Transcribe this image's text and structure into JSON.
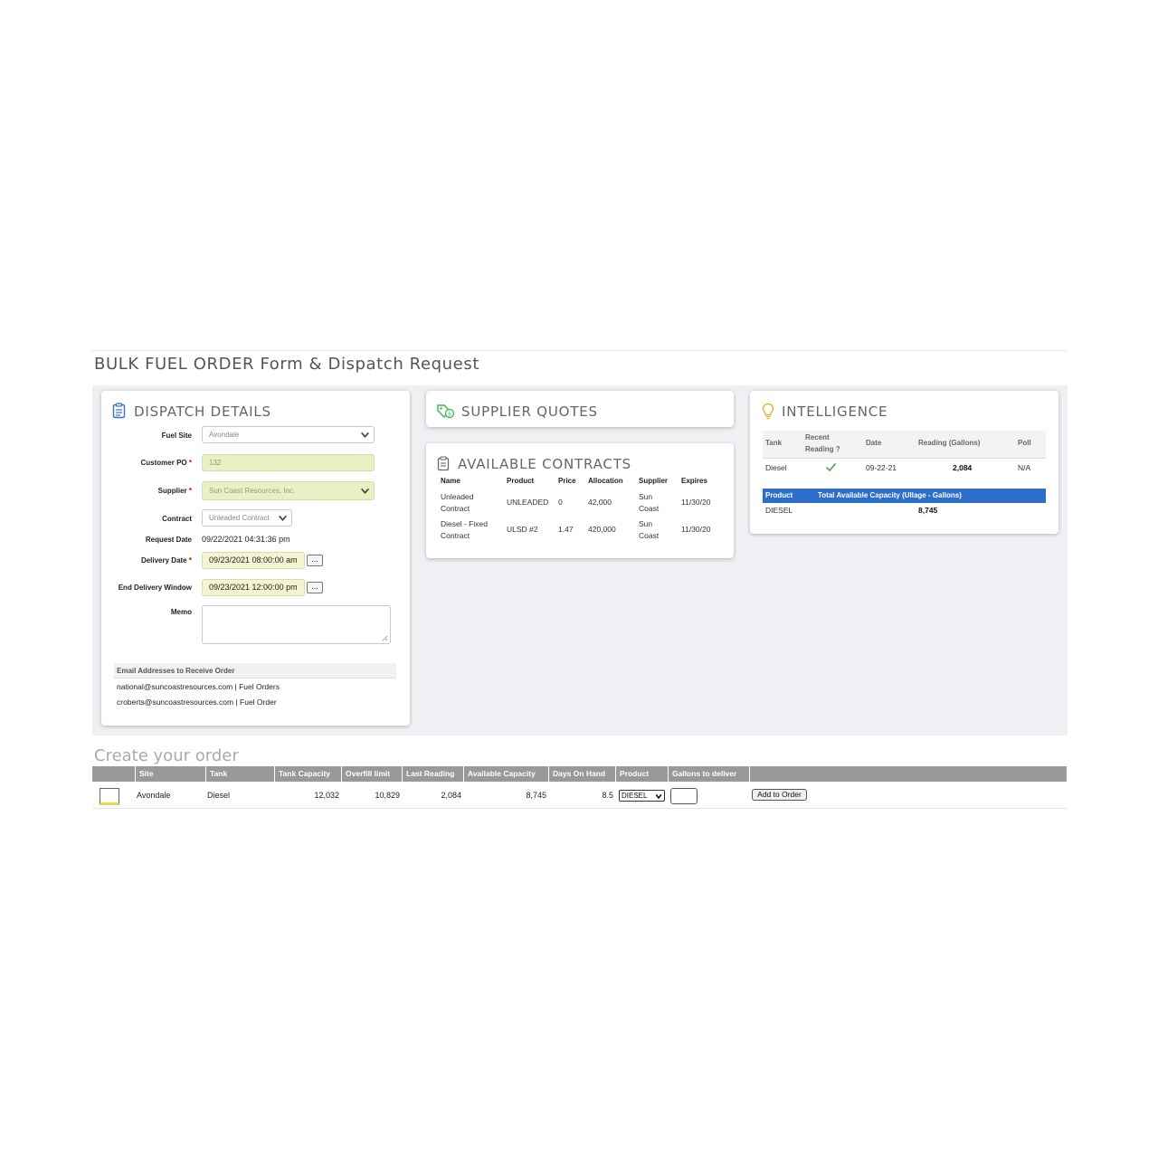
{
  "page_title": "BULK FUEL ORDER Form & Dispatch Request",
  "dispatch": {
    "title": "DISPATCH DETAILS",
    "fuel_site_label": "Fuel Site",
    "fuel_site_value": "Avondale",
    "customer_po_label": "Customer PO",
    "customer_po_value": "132",
    "supplier_label": "Supplier",
    "supplier_value": "Sun Coast Resources, Inc.",
    "contract_label": "Contract",
    "contract_value": "Unleaded Contract",
    "request_date_label": "Request Date",
    "request_date_value": "09/22/2021 04:31:36 pm",
    "delivery_date_label": "Delivery Date",
    "delivery_date_value": "09/23/2021 08:00:00 am",
    "end_window_label": "End Delivery Window",
    "end_window_value": "09/23/2021 12:00:00 pm",
    "picker_label": "...",
    "memo_label": "Memo",
    "memo_value": "",
    "required_mark": "*",
    "email_header": "Email Addresses to Receive Order",
    "emails": [
      "national@suncoastresources.com | Fuel Orders",
      "croberts@suncoastresources.com | Fuel Order"
    ]
  },
  "supplier_quotes": {
    "title": "SUPPLIER QUOTES"
  },
  "contracts": {
    "title": "AVAILABLE CONTRACTS",
    "headers": [
      "Name",
      "Product",
      "Price",
      "Allocation",
      "Supplier",
      "Expires"
    ],
    "rows": [
      {
        "name": "Unleaded Contract",
        "product": "UNLEADED",
        "price": "0",
        "allocation": "42,000",
        "supplier": "Sun Coast",
        "expires": "11/30/20"
      },
      {
        "name": "Diesel - Fixed Contract",
        "product": "ULSD #2",
        "price": "1.47",
        "allocation": "420,000",
        "supplier": "Sun Coast",
        "expires": "11/30/20"
      }
    ]
  },
  "intelligence": {
    "title": "INTELLIGENCE",
    "headers": {
      "tank": "Tank",
      "recent": "Recent Reading ?",
      "date": "Date",
      "reading": "Reading (Gallons)",
      "poll": "Poll"
    },
    "row": {
      "tank": "Diesel",
      "recent_icon": "check-icon",
      "date": "09-22-21",
      "reading": "2,084",
      "poll": "N/A"
    },
    "capacity_headers": {
      "product": "Product",
      "total": "Total Available Capacity (Ullage - Gallons)"
    },
    "capacity_row": {
      "product": "DIESEL",
      "total": "8,745"
    }
  },
  "order": {
    "title": "Create your order",
    "headers": [
      "Site",
      "Tank",
      "Tank Capacity",
      "Overfill limit",
      "Last Reading",
      "Available Capacity",
      "Days On Hand",
      "Product",
      "Gallons to deliver"
    ],
    "row": {
      "site": "Avondale",
      "tank": "Diesel",
      "tank_capacity": "12,032",
      "overfill_limit": "10,829",
      "last_reading": "2,084",
      "available_capacity": "8,745",
      "days_on_hand": "8.5",
      "product": "DIESEL",
      "gallons": ""
    },
    "add_button": "Add to Order"
  },
  "colors": {
    "accent_blue": "#2e6ecb",
    "field_yellow": "#e9f0c4",
    "quotes_green": "#3bb54a",
    "intel_icon": "#e8a81e"
  }
}
